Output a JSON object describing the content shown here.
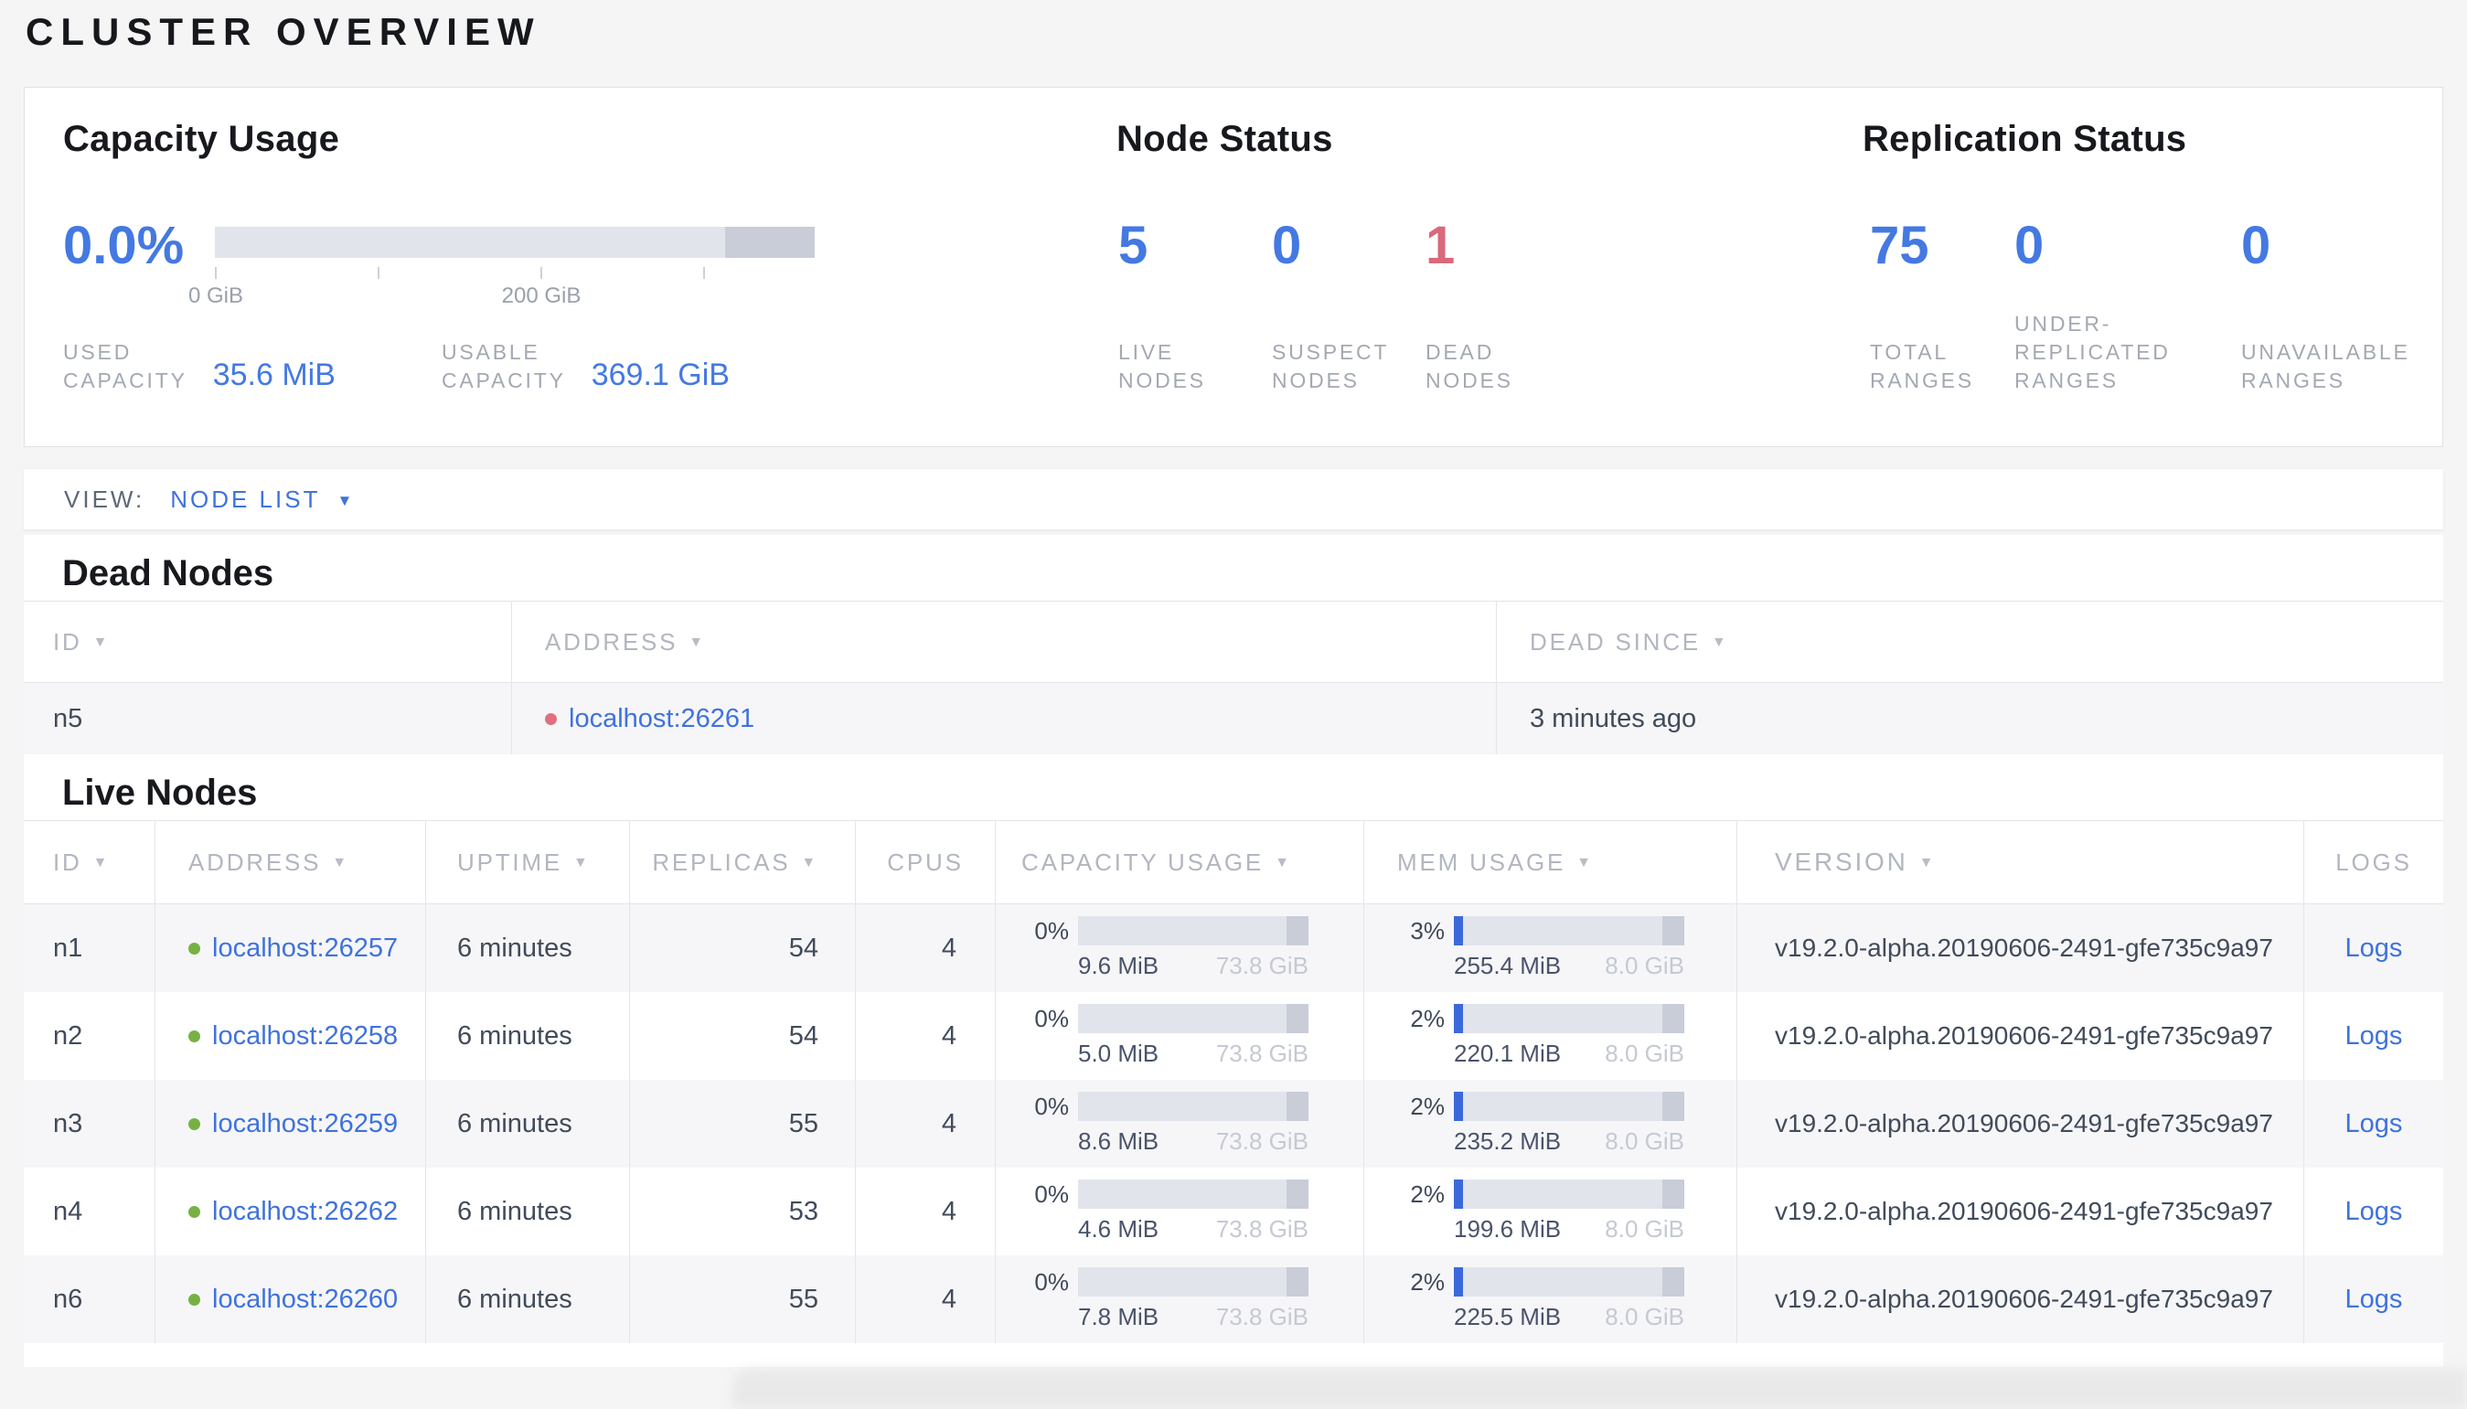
{
  "page": {
    "title": "CLUSTER OVERVIEW"
  },
  "icons": {
    "sort_arrow": "▼",
    "dropdown_arrow": "▼"
  },
  "colors": {
    "blue": "#3f72dd",
    "stat_blue": "#4479e2",
    "red": "#d9697b",
    "green_dot": "#77b144",
    "red_dot": "#e0707e",
    "bar_track": "#e2e4ec",
    "bar_marker": "#c9cdd7",
    "bar_fill": "#3c69da"
  },
  "summary": {
    "capacity": {
      "title": "Capacity Usage",
      "percent": "0.0%",
      "axis_ticks": [
        "0 GiB",
        "200 GiB"
      ],
      "used_label": [
        "USED",
        "CAPACITY"
      ],
      "used_value": "35.6 MiB",
      "usable_label": [
        "USABLE",
        "CAPACITY"
      ],
      "usable_value": "369.1 GiB"
    },
    "node_status": {
      "title": "Node Status",
      "stats": [
        {
          "value": "5",
          "label": [
            "LIVE",
            "NODES"
          ],
          "color": "#4479e2"
        },
        {
          "value": "0",
          "label": [
            "SUSPECT",
            "NODES"
          ],
          "color": "#4479e2"
        },
        {
          "value": "1",
          "label": [
            "DEAD",
            "NODES"
          ],
          "color": "#d9697b"
        }
      ]
    },
    "replication": {
      "title": "Replication Status",
      "stats": [
        {
          "value": "75",
          "label": [
            "TOTAL",
            "RANGES"
          ],
          "color": "#4479e2"
        },
        {
          "value": "0",
          "label": [
            "UNDER-",
            "REPLICATED",
            "RANGES"
          ],
          "color": "#4479e2"
        },
        {
          "value": "0",
          "label": [
            "UNAVAILABLE",
            "RANGES"
          ],
          "color": "#4479e2"
        }
      ]
    }
  },
  "view_bar": {
    "label": "VIEW:",
    "selected": "NODE LIST"
  },
  "dead_nodes": {
    "title": "Dead Nodes",
    "columns": [
      {
        "label": "ID",
        "sorted": true
      },
      {
        "label": "ADDRESS",
        "sorted": true
      },
      {
        "label": "DEAD SINCE",
        "sorted": true
      }
    ],
    "rows": [
      {
        "id": "n5",
        "address": "localhost:26261",
        "dead_since": "3 minutes ago"
      }
    ]
  },
  "live_nodes": {
    "title": "Live Nodes",
    "columns": [
      {
        "label": "ID",
        "sorted": true
      },
      {
        "label": "ADDRESS",
        "sorted": true
      },
      {
        "label": "UPTIME",
        "sorted": true
      },
      {
        "label": "REPLICAS",
        "sorted": true
      },
      {
        "label": "CPUS",
        "sorted": false
      },
      {
        "label": "CAPACITY USAGE",
        "sorted": true
      },
      {
        "label": "MEM USAGE",
        "sorted": true
      },
      {
        "label": "VERSION",
        "sorted": true
      },
      {
        "label": "LOGS",
        "sorted": false
      }
    ],
    "rows": [
      {
        "id": "n1",
        "address": "localhost:26257",
        "uptime": "6 minutes",
        "replicas": "54",
        "cpus": "4",
        "capacity_pct_label": "0%",
        "capacity_pct": 0,
        "capacity_used": "9.6 MiB",
        "capacity_total": "73.8 GiB",
        "mem_pct_label": "3%",
        "mem_pct": 3,
        "mem_used": "255.4 MiB",
        "mem_total": "8.0 GiB",
        "version": "v19.2.0-alpha.20190606-2491-gfe735c9a97",
        "logs": "Logs"
      },
      {
        "id": "n2",
        "address": "localhost:26258",
        "uptime": "6 minutes",
        "replicas": "54",
        "cpus": "4",
        "capacity_pct_label": "0%",
        "capacity_pct": 0,
        "capacity_used": "5.0 MiB",
        "capacity_total": "73.8 GiB",
        "mem_pct_label": "2%",
        "mem_pct": 2,
        "mem_used": "220.1 MiB",
        "mem_total": "8.0 GiB",
        "version": "v19.2.0-alpha.20190606-2491-gfe735c9a97",
        "logs": "Logs"
      },
      {
        "id": "n3",
        "address": "localhost:26259",
        "uptime": "6 minutes",
        "replicas": "55",
        "cpus": "4",
        "capacity_pct_label": "0%",
        "capacity_pct": 0,
        "capacity_used": "8.6 MiB",
        "capacity_total": "73.8 GiB",
        "mem_pct_label": "2%",
        "mem_pct": 2,
        "mem_used": "235.2 MiB",
        "mem_total": "8.0 GiB",
        "version": "v19.2.0-alpha.20190606-2491-gfe735c9a97",
        "logs": "Logs"
      },
      {
        "id": "n4",
        "address": "localhost:26262",
        "uptime": "6 minutes",
        "replicas": "53",
        "cpus": "4",
        "capacity_pct_label": "0%",
        "capacity_pct": 0,
        "capacity_used": "4.6 MiB",
        "capacity_total": "73.8 GiB",
        "mem_pct_label": "2%",
        "mem_pct": 2,
        "mem_used": "199.6 MiB",
        "mem_total": "8.0 GiB",
        "version": "v19.2.0-alpha.20190606-2491-gfe735c9a97",
        "logs": "Logs"
      },
      {
        "id": "n6",
        "address": "localhost:26260",
        "uptime": "6 minutes",
        "replicas": "55",
        "cpus": "4",
        "capacity_pct_label": "0%",
        "capacity_pct": 0,
        "capacity_used": "7.8 MiB",
        "capacity_total": "73.8 GiB",
        "mem_pct_label": "2%",
        "mem_pct": 2,
        "mem_used": "225.5 MiB",
        "mem_total": "8.0 GiB",
        "version": "v19.2.0-alpha.20190606-2491-gfe735c9a97",
        "logs": "Logs"
      }
    ]
  }
}
